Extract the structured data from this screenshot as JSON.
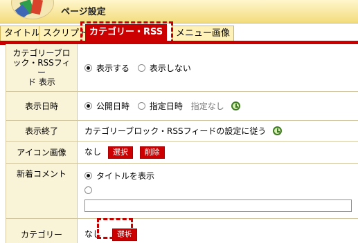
{
  "header": {
    "title": "ページ設定"
  },
  "tabs": [
    {
      "label": "タイトル",
      "active": false
    },
    {
      "label": "スクリプト",
      "active": false
    },
    {
      "label": "カテゴリー・RSS",
      "active": true
    },
    {
      "label": "メニュー画像",
      "active": false
    }
  ],
  "form": {
    "category_block": {
      "label_lines": [
        "カテゴリーブロ",
        "ック・RSSフィー",
        "ド 表示"
      ],
      "option_show": "表示する",
      "option_hide": "表示しない",
      "selected": "show"
    },
    "display_date": {
      "label": "表示日時",
      "option_publish": "公開日時",
      "option_specify": "指定日時",
      "specify_value": "指定なし"
    },
    "display_end": {
      "label": "表示終了",
      "value": "カテゴリーブロック・RSSフィードの設定に従う"
    },
    "icon_image": {
      "label": "アイコン画像",
      "value": "なし",
      "select_label": "選択",
      "delete_label": "削除"
    },
    "new_comment": {
      "label": "新着コメント",
      "option_title": "タイトルを表示",
      "custom_value": ""
    },
    "category": {
      "label": "カテゴリー",
      "value": "なし",
      "select_label": "選択"
    }
  },
  "colors": {
    "accent": "#cc0000",
    "label_bg": "#f9f3d8",
    "header_bg": "#f3dc7c"
  }
}
